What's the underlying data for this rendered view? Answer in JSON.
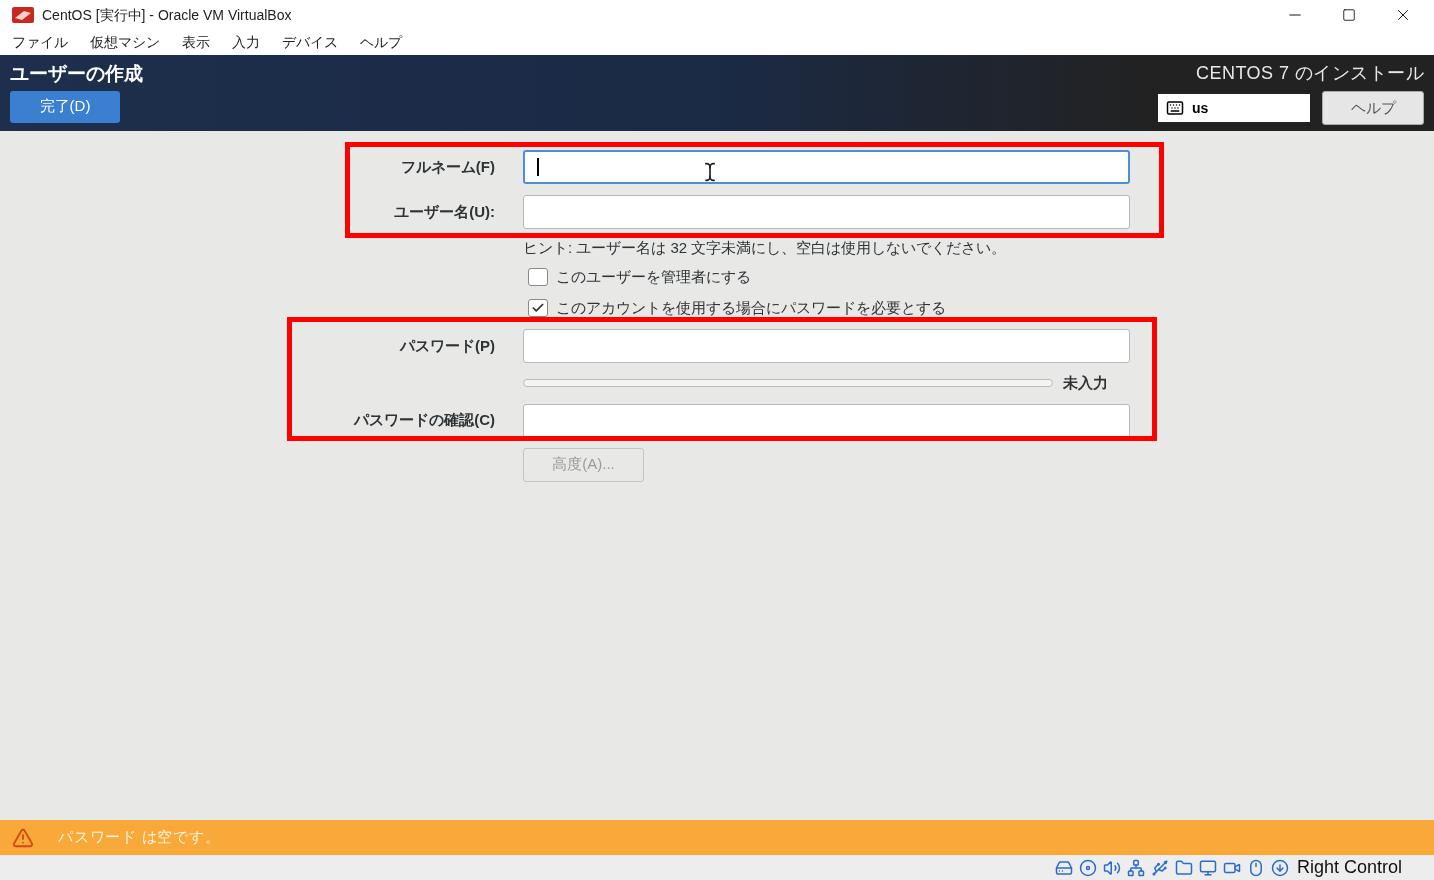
{
  "window": {
    "title": "CentOS [実行中] - Oracle VM VirtualBox"
  },
  "menu": [
    "ファイル",
    "仮想マシン",
    "表示",
    "入力",
    "デバイス",
    "ヘルプ"
  ],
  "header": {
    "title": "ユーザーの作成",
    "done_button": "完了(D)",
    "product": "CENTOS 7 のインストール",
    "keyboard_layout": "us",
    "help_button": "ヘルプ"
  },
  "form": {
    "full_name": {
      "label": "フルネーム(F)",
      "focused": true
    },
    "user_name": {
      "label": "ユーザー名(U):",
      "focused": false
    },
    "hint": "ヒント: ユーザー名は 32 文字未満にし、空白は使用しないでください。",
    "checkboxes": [
      {
        "label": "このユーザーを管理者にする",
        "checked": false
      },
      {
        "label": "このアカウントを使用する場合にパスワードを必要とする",
        "checked": true
      }
    ],
    "password": {
      "label": "パスワード(P)",
      "focused": false
    },
    "strength": {
      "level": 0,
      "reading": "未入力"
    },
    "confirm": {
      "label": "パスワードの確認(C)",
      "focused": false
    },
    "advanced_button": {
      "label": "高度(A)...",
      "disabled": true
    }
  },
  "warning": {
    "message": "パスワード は空です。"
  },
  "status_bar": {
    "host_key": "Right Control"
  }
}
